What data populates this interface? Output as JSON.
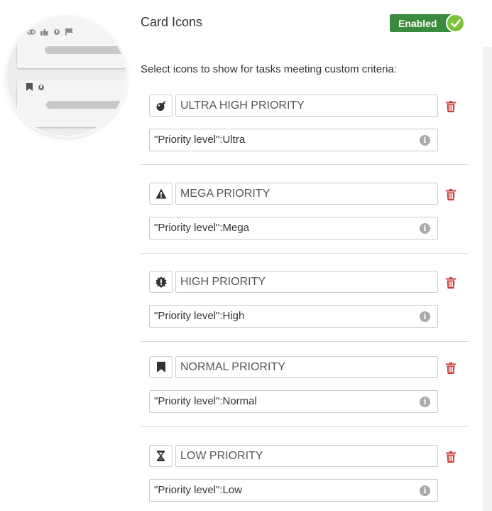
{
  "section": {
    "title": "Card Icons",
    "toggle_label": "Enabled",
    "description": "Select icons to show for tasks meeting custom criteria:"
  },
  "colors": {
    "toggle_on": "#3a8a3f",
    "toggle_knob": "#7cc33a",
    "delete": "#d03b35"
  },
  "rules": [
    {
      "icon": "bomb-icon",
      "name": "ULTRA HIGH PRIORITY",
      "query": "\"Priority level\":Ultra"
    },
    {
      "icon": "warning-icon",
      "name": "MEGA PRIORITY",
      "query": "\"Priority level\":Mega"
    },
    {
      "icon": "bug-icon",
      "name": "HIGH PRIORITY",
      "query": "\"Priority level\":High"
    },
    {
      "icon": "bookmark-icon",
      "name": "NORMAL PRIORITY",
      "query": "\"Priority level\":Normal"
    },
    {
      "icon": "hourglass-icon",
      "name": "LOW PRIORITY",
      "query": "\"Priority level\":Low"
    }
  ]
}
